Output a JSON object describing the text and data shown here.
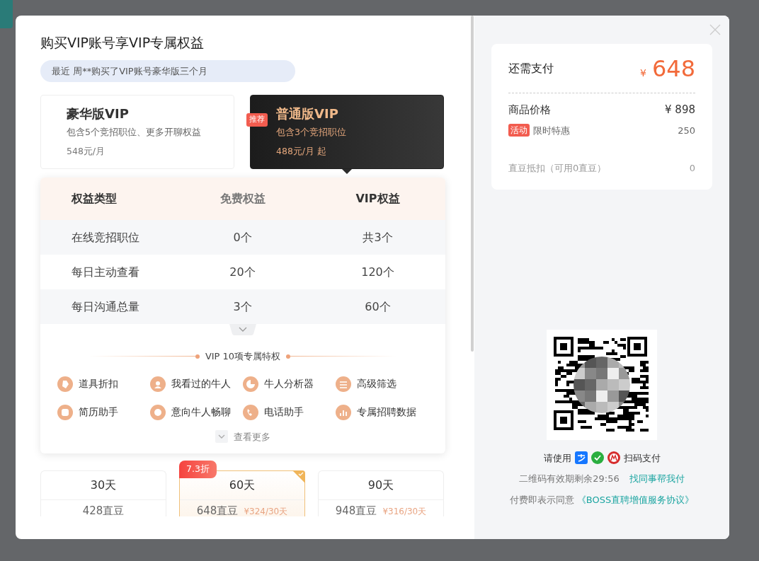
{
  "title": "购买VIP账号享VIP专属权益",
  "notice": "最近 周**购买了VIP账号豪华版三个月",
  "packages": [
    {
      "name": "豪华版VIP",
      "desc": "包含5个竞招职位、更多开聊权益",
      "price": "548元/月",
      "selected": false
    },
    {
      "name": "普通版VIP",
      "desc": "包含3个竞招职位",
      "price": "488元/月 起",
      "badge": "推荐",
      "selected": true
    }
  ],
  "table": {
    "columns": [
      "权益类型",
      "免费权益",
      "VIP权益"
    ],
    "rows": [
      [
        "在线竞招职位",
        "0个",
        "共3个"
      ],
      [
        "每日主动查看",
        "20个",
        "120个"
      ],
      [
        "每日沟通总量",
        "3个",
        "60个"
      ]
    ]
  },
  "privileges": {
    "title": "VIP 10项专属特权",
    "items": [
      "道具折扣",
      "我看过的牛人",
      "牛人分析器",
      "高级筛选",
      "简历助手",
      "意向牛人畅聊",
      "电话助手",
      "专属招聘数据"
    ],
    "more": "查看更多"
  },
  "plans": [
    {
      "days": "30天",
      "price": "428直豆",
      "selected": false
    },
    {
      "days": "60天",
      "price": "648直豆",
      "unit_price": "¥324/30天",
      "discount": "7.3折",
      "selected": true
    },
    {
      "days": "90天",
      "price": "948直豆",
      "unit_price": "¥316/30天",
      "selected": false
    }
  ],
  "summary": {
    "due_label": "还需支付",
    "currency": "¥",
    "due": "648",
    "lines": [
      {
        "label": "商品价格",
        "value": "¥ 898",
        "kind": "main"
      },
      {
        "label": "限时特惠",
        "tag": "活动",
        "value": "250",
        "kind": "promo"
      },
      {
        "label": "直豆抵扣（可用0直豆）",
        "value": "0",
        "kind": "muted"
      }
    ]
  },
  "payment": {
    "prompt": "请使用",
    "action": "扫码支付",
    "expiry": "二维码有效期剩余29:56",
    "helper_link": "找同事帮我付",
    "agreement": "付费即表示同意",
    "agreement_link": "《BOSS直聘增值服务协议》"
  }
}
